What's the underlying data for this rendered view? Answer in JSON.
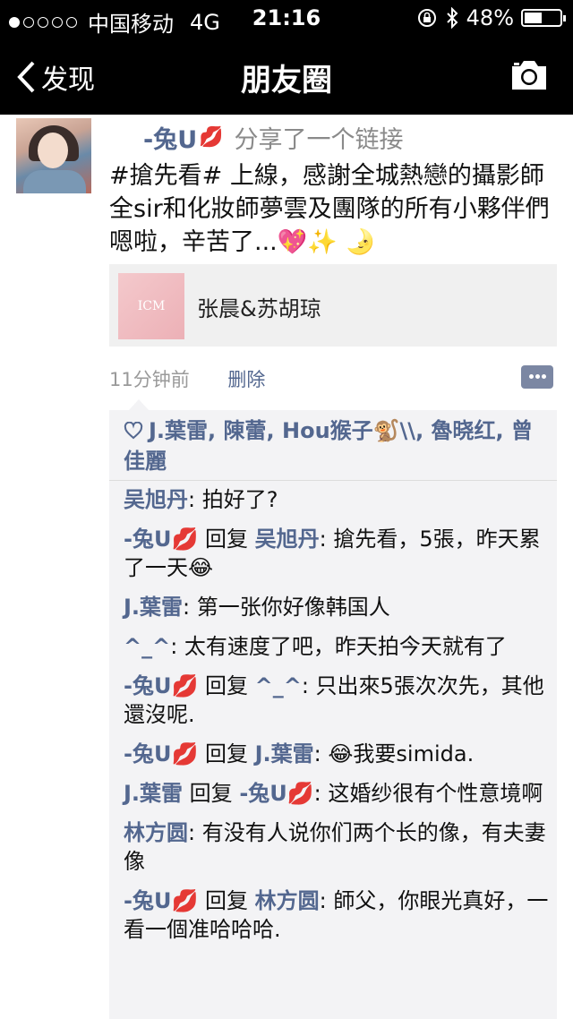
{
  "status_bar": {
    "carrier": "中国移动",
    "network": "4G",
    "time": "21:16",
    "battery": "48%"
  },
  "nav": {
    "back_label": "发现",
    "title": "朋友圈"
  },
  "post": {
    "author": "-兔U",
    "action": "分享了一个链接",
    "text": "#搶先看# 上線，感謝全城熱戀的攝影師全sir和化妝師夢雲及團隊的所有小夥伴們嗯啦，辛苦了...💖✨ 🌛",
    "link": {
      "thumb_text": "ICM",
      "title": "张晨&苏胡琼"
    },
    "time": "11分钟前",
    "delete_label": "删除"
  },
  "likes": {
    "names": "J.葉雷, 陳蕾, Hou猴子🐒\\\\, 魯晓红, 曾佳麗"
  },
  "comments": [
    {
      "name": "吴旭丹",
      "reply": "",
      "reply_to": "",
      "text": ": 拍好了?"
    },
    {
      "name": "-兔U💋",
      "reply": " 回复 ",
      "reply_to": "吴旭丹",
      "text": ": 搶先看，5張，昨天累了一天😂"
    },
    {
      "name": "J.葉雷",
      "reply": "",
      "reply_to": "",
      "text": ": 第一张你好像韩国人"
    },
    {
      "name": "^_^",
      "reply": "",
      "reply_to": "",
      "text": ": 太有速度了吧，昨天拍今天就有了"
    },
    {
      "name": "-兔U💋",
      "reply": " 回复 ",
      "reply_to": "^_^",
      "text": ": 只出來5張次次先，其他還沒呢."
    },
    {
      "name": "-兔U💋",
      "reply": " 回复 ",
      "reply_to": "J.葉雷",
      "text": ": 😂我要simida."
    },
    {
      "name": "J.葉雷",
      "reply": " 回复 ",
      "reply_to": "-兔U💋",
      "text": ": 这婚纱很有个性意境啊"
    },
    {
      "name": "林方圆",
      "reply": "",
      "reply_to": "",
      "text": ": 有没有人说你们两个长的像，有夫妻像"
    },
    {
      "name": "-兔U💋",
      "reply": " 回复 ",
      "reply_to": "林方圆",
      "text": ": 師父，你眼光真好，一看一個准哈哈哈."
    }
  ]
}
